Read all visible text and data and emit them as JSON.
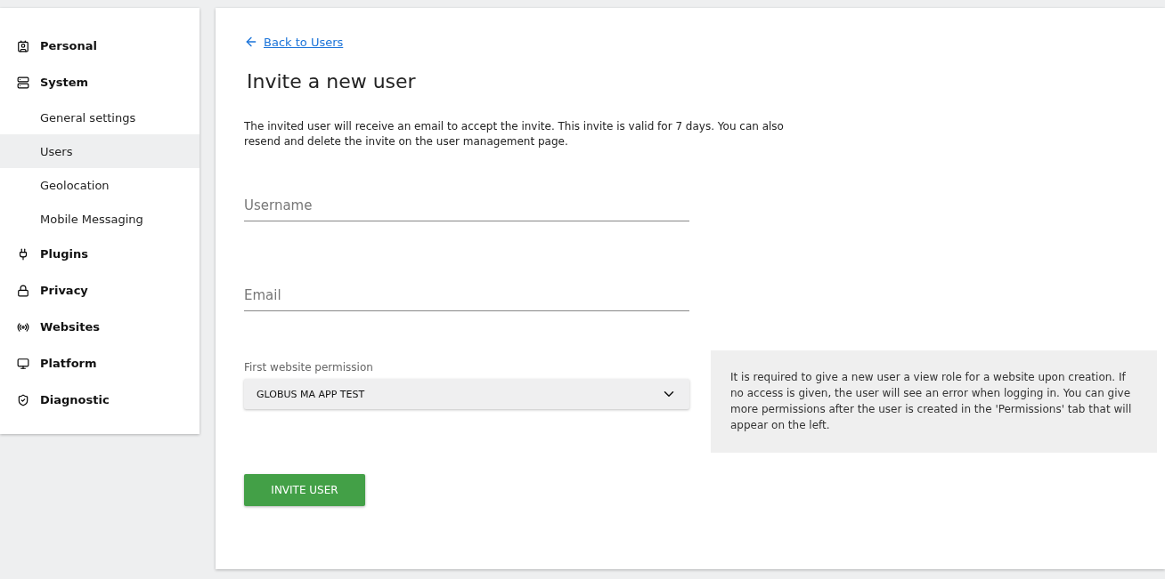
{
  "sidebar": {
    "items": [
      {
        "label": "Personal"
      },
      {
        "label": "System",
        "children": [
          {
            "label": "General settings",
            "selected": false
          },
          {
            "label": "Users",
            "selected": true
          },
          {
            "label": "Geolocation",
            "selected": false
          },
          {
            "label": "Mobile Messaging",
            "selected": false
          }
        ]
      },
      {
        "label": "Plugins"
      },
      {
        "label": "Privacy"
      },
      {
        "label": "Websites"
      },
      {
        "label": "Platform"
      },
      {
        "label": "Diagnostic"
      }
    ]
  },
  "main": {
    "back_link": "Back to Users",
    "title": "Invite a new user",
    "description": "The invited user will receive an email to accept the invite. This invite is valid for 7 days. You can also resend and delete the invite on the user management page.",
    "fields": [
      {
        "placeholder": "Username"
      },
      {
        "placeholder": "Email"
      }
    ],
    "permission": {
      "label": "First website permission",
      "value": "GLOBUS MA APP TEST"
    },
    "note": "It is required to give a new user a view role for a website upon creation. If no access is given, the user will see an error when logging in. You can give more permissions after the user is created in the 'Permissions' tab that will appear on the left.",
    "button": "INVITE USER"
  }
}
